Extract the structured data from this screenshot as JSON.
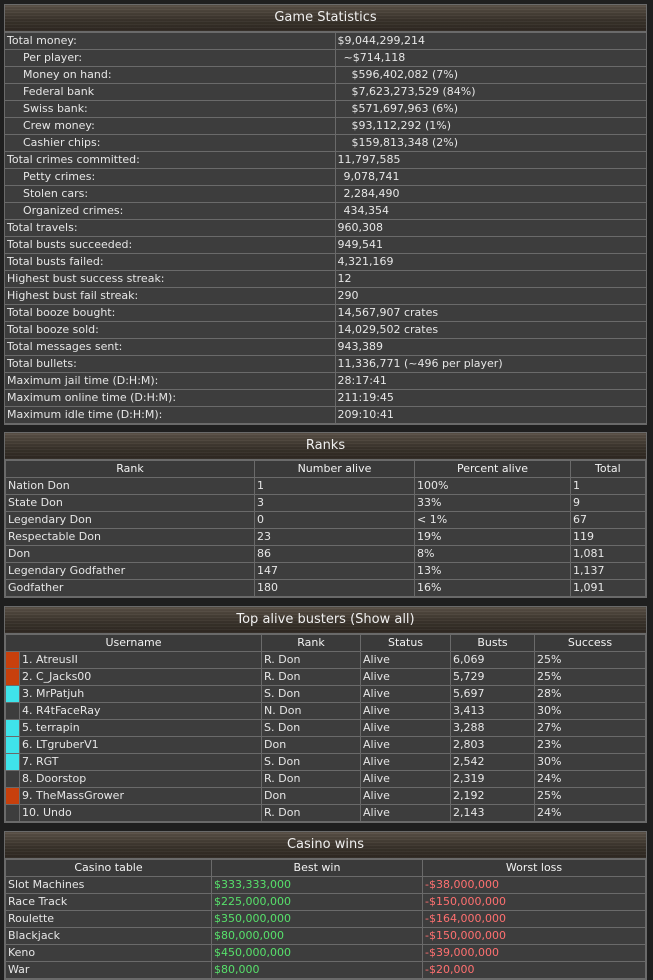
{
  "game_statistics": {
    "title": "Game Statistics",
    "rows": [
      {
        "label": "Total money:",
        "value": "$9,044,299,214",
        "indent": false,
        "vindent": 0
      },
      {
        "label": "Per player:",
        "value": "~$714,118",
        "indent": true,
        "vindent": 1
      },
      {
        "label": "Money on hand:",
        "value": "$596,402,082 (7%)",
        "indent": true,
        "vindent": 2
      },
      {
        "label": "Federal bank",
        "value": "$7,623,273,529 (84%)",
        "indent": true,
        "vindent": 2
      },
      {
        "label": "Swiss bank:",
        "value": "$571,697,963 (6%)",
        "indent": true,
        "vindent": 2
      },
      {
        "label": "Crew money:",
        "value": "$93,112,292 (1%)",
        "indent": true,
        "vindent": 2
      },
      {
        "label": "Cashier chips:",
        "value": "$159,813,348 (2%)",
        "indent": true,
        "vindent": 2
      },
      {
        "label": "Total crimes committed:",
        "value": "11,797,585",
        "indent": false,
        "vindent": 0
      },
      {
        "label": "Petty crimes:",
        "value": "9,078,741",
        "indent": true,
        "vindent": 1
      },
      {
        "label": "Stolen cars:",
        "value": "2,284,490",
        "indent": true,
        "vindent": 1
      },
      {
        "label": "Organized crimes:",
        "value": "434,354",
        "indent": true,
        "vindent": 1
      },
      {
        "label": "Total travels:",
        "value": "960,308",
        "indent": false,
        "vindent": 0
      },
      {
        "label": "Total busts succeeded:",
        "value": "949,541",
        "indent": false,
        "vindent": 0
      },
      {
        "label": "Total busts failed:",
        "value": "4,321,169",
        "indent": false,
        "vindent": 0
      },
      {
        "label": "Highest bust success streak:",
        "value": "12",
        "indent": false,
        "vindent": 0
      },
      {
        "label": "Highest bust fail streak:",
        "value": "290",
        "indent": false,
        "vindent": 0
      },
      {
        "label": "Total booze bought:",
        "value": "14,567,907 crates",
        "indent": false,
        "vindent": 0
      },
      {
        "label": "Total booze sold:",
        "value": "14,029,502 crates",
        "indent": false,
        "vindent": 0
      },
      {
        "label": "Total messages sent:",
        "value": "943,389",
        "indent": false,
        "vindent": 0
      },
      {
        "label": "Total bullets:",
        "value": "11,336,771 (~496 per player)",
        "indent": false,
        "vindent": 0
      },
      {
        "label": "Maximum jail time (D:H:M):",
        "value": "28:17:41",
        "indent": false,
        "vindent": 0
      },
      {
        "label": "Maximum online time (D:H:M):",
        "value": "211:19:45",
        "indent": false,
        "vindent": 0
      },
      {
        "label": "Maximum idle time (D:H:M):",
        "value": "209:10:41",
        "indent": false,
        "vindent": 0
      }
    ]
  },
  "ranks": {
    "title": "Ranks",
    "headers": [
      "Rank",
      "Number alive",
      "Percent alive",
      "Total"
    ],
    "rows": [
      [
        "Nation Don",
        "1",
        "100%",
        "1"
      ],
      [
        "State Don",
        "3",
        "33%",
        "9"
      ],
      [
        "Legendary Don",
        "0",
        "< 1%",
        "67"
      ],
      [
        "Respectable Don",
        "23",
        "19%",
        "119"
      ],
      [
        "Don",
        "86",
        "8%",
        "1,081"
      ],
      [
        "Legendary Godfather",
        "147",
        "13%",
        "1,137"
      ],
      [
        "Godfather",
        "180",
        "16%",
        "1,091"
      ]
    ]
  },
  "busters": {
    "title": "Top alive busters (Show all)",
    "headers": [
      "Username",
      "Rank",
      "Status",
      "Busts",
      "Success"
    ],
    "rows": [
      {
        "color": "#c8400c",
        "name": "1. AtreusII",
        "rank": "R. Don",
        "status": "Alive",
        "busts": "6,069",
        "success": "25%"
      },
      {
        "color": "#c8400c",
        "name": "2. C_Jacks00",
        "rank": "R. Don",
        "status": "Alive",
        "busts": "5,729",
        "success": "25%"
      },
      {
        "color": "#3fe3ea",
        "name": "3. MrPatjuh",
        "rank": "S. Don",
        "status": "Alive",
        "busts": "5,697",
        "success": "28%"
      },
      {
        "color": "",
        "name": "4. R4tFaceRay",
        "rank": "N. Don",
        "status": "Alive",
        "busts": "3,413",
        "success": "30%"
      },
      {
        "color": "#3fe3ea",
        "name": "5. terrapin",
        "rank": "S. Don",
        "status": "Alive",
        "busts": "3,288",
        "success": "27%"
      },
      {
        "color": "#3fe3ea",
        "name": "6. LTgruberV1",
        "rank": "Don",
        "status": "Alive",
        "busts": "2,803",
        "success": "23%"
      },
      {
        "color": "#3fe3ea",
        "name": "7. RGT",
        "rank": "S. Don",
        "status": "Alive",
        "busts": "2,542",
        "success": "30%"
      },
      {
        "color": "",
        "name": "8. Doorstop",
        "rank": "R. Don",
        "status": "Alive",
        "busts": "2,319",
        "success": "24%"
      },
      {
        "color": "#c8400c",
        "name": "9. TheMassGrower",
        "rank": "Don",
        "status": "Alive",
        "busts": "2,192",
        "success": "25%"
      },
      {
        "color": "",
        "name": "10. Undo",
        "rank": "R. Don",
        "status": "Alive",
        "busts": "2,143",
        "success": "24%"
      }
    ]
  },
  "casino": {
    "title": "Casino wins",
    "headers": [
      "Casino table",
      "Best win",
      "Worst loss"
    ],
    "colors": {
      "win": "#57e06b",
      "loss": "#ff7070"
    },
    "rows": [
      [
        "Slot Machines",
        "$333,333,000",
        "-$38,000,000"
      ],
      [
        "Race Track",
        "$225,000,000",
        "-$150,000,000"
      ],
      [
        "Roulette",
        "$350,000,000",
        "-$164,000,000"
      ],
      [
        "Blackjack",
        "$80,000,000",
        "-$150,000,000"
      ],
      [
        "Keno",
        "$450,000,000",
        "-$39,000,000"
      ],
      [
        "War",
        "$80,000",
        "-$20,000"
      ]
    ]
  }
}
